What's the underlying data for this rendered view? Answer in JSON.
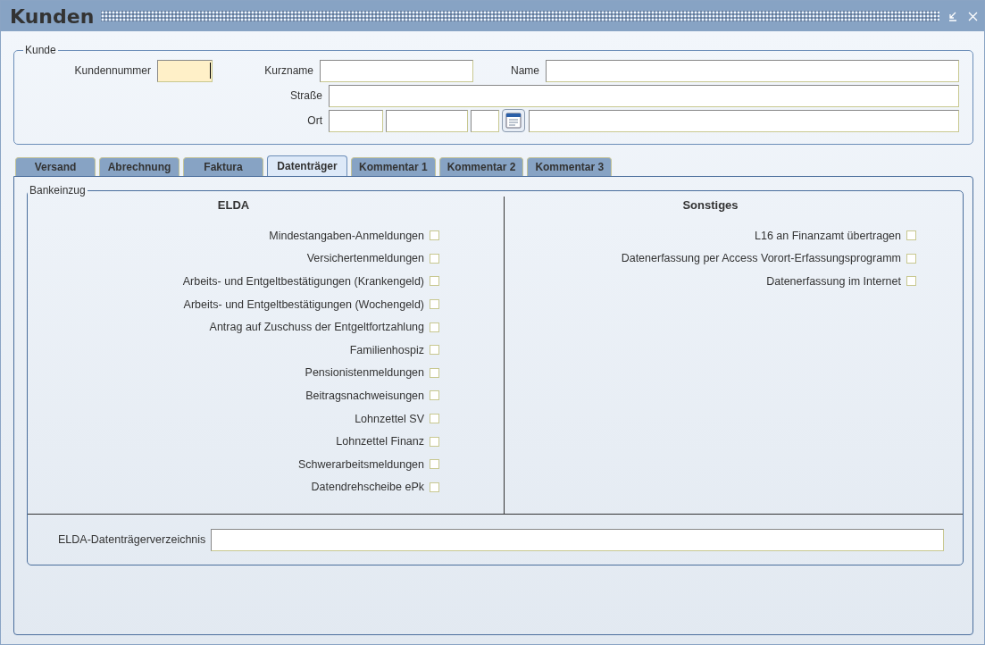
{
  "window": {
    "title": "Kunden"
  },
  "customer": {
    "legend": "Kunde",
    "number": {
      "label": "Kundennummer",
      "focused": true
    },
    "short_name": {
      "label": "Kurzname"
    },
    "name": {
      "label": "Name"
    },
    "street": {
      "label": "Straße"
    },
    "city": {
      "label": "Ort"
    }
  },
  "tabs": [
    {
      "label": "Versand",
      "selected": false
    },
    {
      "label": "Abrechnung",
      "selected": false
    },
    {
      "label": "Faktura",
      "selected": false
    },
    {
      "label": "Datenträger",
      "selected": true
    },
    {
      "label": "Kommentar 1",
      "selected": false
    },
    {
      "label": "Kommentar 2",
      "selected": false
    },
    {
      "label": "Kommentar 3",
      "selected": false
    }
  ],
  "group": {
    "legend": "Bankeinzug",
    "columns": [
      {
        "heading": "ELDA",
        "items": [
          {
            "label": "Mindestangaben-Anmeldungen",
            "checked": false
          },
          {
            "label": "Versichertenmeldungen",
            "checked": false
          },
          {
            "label": "Arbeits- und Entgeltbestätigungen (Krankengeld)",
            "checked": false
          },
          {
            "label": "Arbeits- und Entgeltbestätigungen (Wochengeld)",
            "checked": false
          },
          {
            "label": "Antrag auf Zuschuss der Entgeltfortzahlung",
            "checked": false
          },
          {
            "label": "Familienhospiz",
            "checked": false
          },
          {
            "label": "Pensionistenmeldungen",
            "checked": false
          },
          {
            "label": "Beitragsnachweisungen",
            "checked": false
          },
          {
            "label": "Lohnzettel SV",
            "checked": false
          },
          {
            "label": "Lohnzettel Finanz",
            "checked": false
          },
          {
            "label": "Schwerarbeitsmeldungen",
            "checked": false
          },
          {
            "label": "Datendrehscheibe ePk",
            "checked": false
          }
        ]
      },
      {
        "heading": "Sonstiges",
        "items": [
          {
            "label": "L16 an Finanzamt übertragen",
            "checked": false
          },
          {
            "label": "Datenerfassung per Access Vorort-Erfassungsprogramm",
            "checked": false
          },
          {
            "label": "Datenerfassung im Internet",
            "checked": false
          }
        ]
      }
    ],
    "directory": {
      "label": "ELDA-Datenträgerverzeichnis"
    }
  }
}
